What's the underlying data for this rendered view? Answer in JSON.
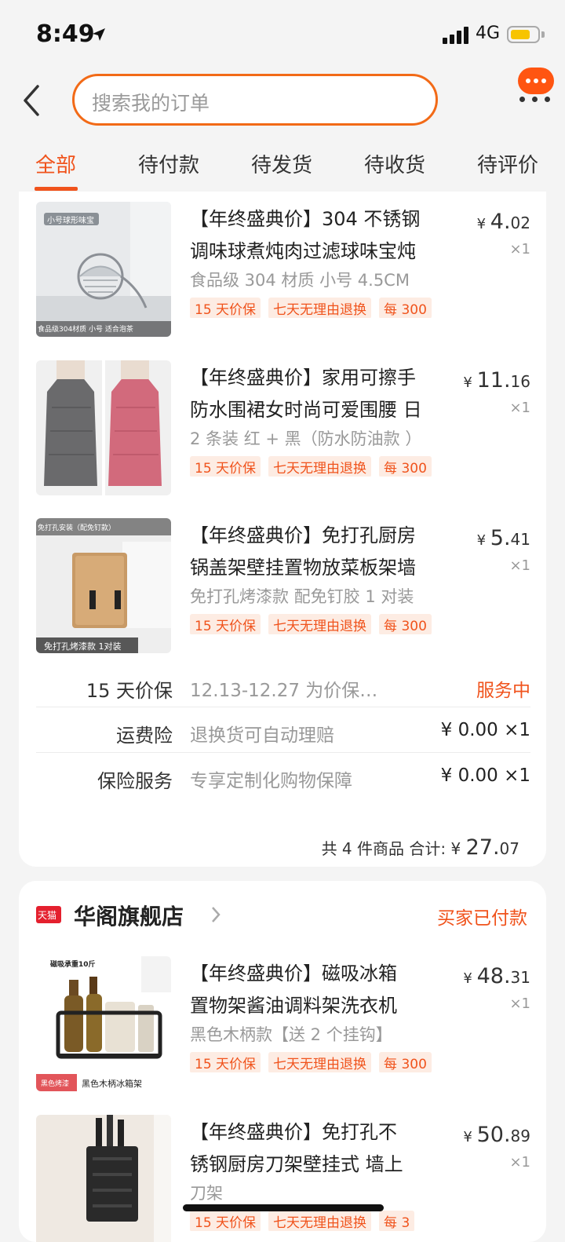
{
  "status_bar": {
    "time": "8:49",
    "network": "4G",
    "battery_level": 0.7
  },
  "search": {
    "placeholder": "搜索我的订单"
  },
  "tabs": [
    {
      "label": "全部",
      "active": true
    },
    {
      "label": "待付款",
      "active": false
    },
    {
      "label": "待发货",
      "active": false
    },
    {
      "label": "待收货",
      "active": false
    },
    {
      "label": "待评价",
      "active": false
    }
  ],
  "order1": {
    "items": [
      {
        "title_line1": "【年终盛典价】304 不锈钢",
        "title_line2": "调味球煮炖肉过滤球味宝炖",
        "sku": "食品级 304 材质 小号 4.5CM",
        "tags": [
          "15 天价保",
          "七天无理由退换",
          "每 300"
        ],
        "price_int": "4.",
        "price_dec": "02",
        "currency": "¥",
        "qty": "×1",
        "thumb_caption_top": "小号球形味宝",
        "thumb_caption_bottom": "食品级304材质 小号 适合泡茶"
      },
      {
        "title_line1": "【年终盛典价】家用可擦手",
        "title_line2": "防水围裙女时尚可爱围腰 日",
        "sku": "2 条装 红 + 黑（防水防油款 ）",
        "tags": [
          "15 天价保",
          "七天无理由退换",
          "每 300"
        ],
        "price_int": "11.",
        "price_dec": "16",
        "currency": "¥",
        "qty": "×1",
        "thumb_caption_top": "",
        "thumb_caption_bottom": ""
      },
      {
        "title_line1": "【年终盛典价】免打孔厨房",
        "title_line2": "锅盖架壁挂置物放菜板架墙",
        "sku": "免打孔烤漆款 配免钉胶 1 对装",
        "tags": [
          "15 天价保",
          "七天无理由退换",
          "每 300"
        ],
        "price_int": "5.",
        "price_dec": "41",
        "currency": "¥",
        "qty": "×1",
        "thumb_caption_top": "免打孔安装（配免钉款）",
        "thumb_caption_bottom": "免打孔烤漆款 1对装"
      }
    ],
    "services": [
      {
        "label": "15 天价保",
        "desc": "12.13-12.27 为价保…",
        "value": "服务中",
        "accent": true
      },
      {
        "label": "运费险",
        "desc": "退换货可自动理赔",
        "value": "¥ 0.00 ×1",
        "accent": false
      },
      {
        "label": "保险服务",
        "desc": "专享定制化购物保障",
        "value": "¥ 0.00 ×1",
        "accent": false
      }
    ],
    "total": {
      "count_text": "共 4 件商品",
      "sum_label": "合计:",
      "currency": "¥",
      "sum_int": "27.",
      "sum_dec": "07"
    }
  },
  "order2": {
    "store_badge": "天猫",
    "store_name": "华阁旗舰店",
    "status": "买家已付款",
    "items": [
      {
        "title_line1": "【年终盛典价】磁吸冰箱",
        "title_line2": "置物架酱油调料架洗衣机",
        "sku": "黑色木柄款【送 2 个挂钩】",
        "tags": [
          "15 天价保",
          "七天无理由退换",
          "每 300"
        ],
        "price_int": "48.",
        "price_dec": "31",
        "currency": "¥",
        "qty": "×1",
        "thumb_caption_top": "磁吸承重10斤",
        "thumb_caption_bottom": "黑色木柄冰箱架",
        "thumb_badge": "黑色烤漆"
      },
      {
        "title_line1": "【年终盛典价】免打孔不",
        "title_line2": "锈钢厨房刀架壁挂式 墙上",
        "sku": "刀架",
        "tags": [
          "15 天价保",
          "七天无理由退换",
          "每 3"
        ],
        "price_int": "50.",
        "price_dec": "89",
        "currency": "¥",
        "qty": "×1",
        "thumb_caption_top": "",
        "thumb_caption_bottom": ""
      }
    ]
  },
  "colors": {
    "accent": "#f0531c",
    "search_border": "#f26a17",
    "tmall_red": "#e4202e"
  }
}
